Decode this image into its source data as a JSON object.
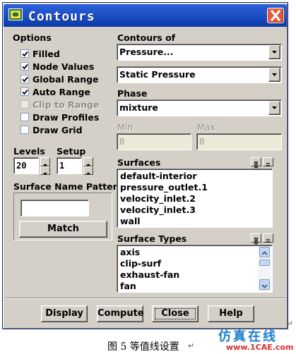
{
  "window": {
    "title": "Contours",
    "close_symbol": "X"
  },
  "options": {
    "heading": "Options",
    "items": [
      {
        "label": "Filled",
        "checked": true,
        "enabled": true
      },
      {
        "label": "Node Values",
        "checked": true,
        "enabled": true
      },
      {
        "label": "Global Range",
        "checked": true,
        "enabled": true
      },
      {
        "label": "Auto Range",
        "checked": true,
        "enabled": true
      },
      {
        "label": "Clip to Range",
        "checked": false,
        "enabled": false
      },
      {
        "label": "Draw Profiles",
        "checked": false,
        "enabled": true
      },
      {
        "label": "Draw Grid",
        "checked": false,
        "enabled": true
      }
    ]
  },
  "levels": {
    "label": "Levels",
    "value": "20"
  },
  "setup": {
    "label": "Setup",
    "value": "1"
  },
  "surface_name_pattern": {
    "label": "Surface Name Pattern",
    "value": "",
    "match_label": "Match"
  },
  "contours_of": {
    "label": "Contours of",
    "category": "Pressure...",
    "variable": "Static Pressure"
  },
  "phase": {
    "label": "Phase",
    "value": "mixture"
  },
  "min": {
    "label": "Min",
    "value": "0"
  },
  "max": {
    "label": "Max",
    "value": "0"
  },
  "surfaces": {
    "label": "Surfaces",
    "items": [
      "default-interior",
      "pressure_outlet.1",
      "velocity_inlet.2",
      "velocity_inlet.3",
      "wall"
    ]
  },
  "surface_types": {
    "label": "Surface Types",
    "items": [
      "axis",
      "clip-surf",
      "exhaust-fan",
      "fan"
    ]
  },
  "buttons": {
    "display": "Display",
    "compute": "Compute",
    "close": "Close",
    "help": "Help"
  },
  "caption": {
    "text": "图 5 等值线设置",
    "mark": "↵"
  },
  "watermark": {
    "text": "仿真在线",
    "url": "www.1CAE.com"
  },
  "colors": {
    "titlebar": "#0b3aa8",
    "panel": "#d4d0c8",
    "close": "#e35a3c",
    "watermark": "#1a7fd0"
  }
}
